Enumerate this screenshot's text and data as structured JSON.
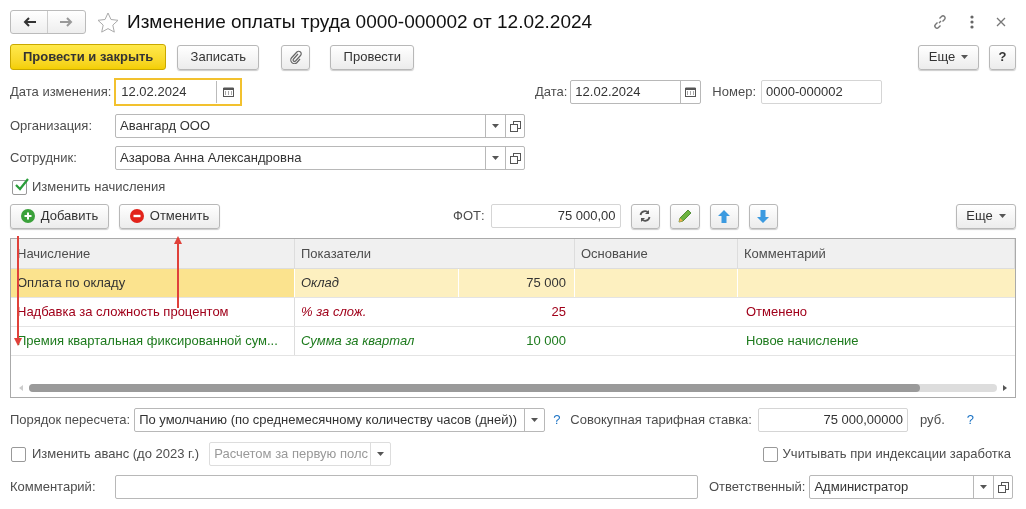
{
  "window": {
    "title": "Изменение оплаты труда 0000-000002 от 12.02.2024",
    "favorite": false
  },
  "toolbar": {
    "primary": "Провести и закрыть",
    "buttons": [
      "Записать",
      "Провести"
    ],
    "more": "Еще",
    "help": "?"
  },
  "header": {
    "change_date": {
      "label": "Дата изменения:",
      "value": "12.02.2024"
    },
    "date": {
      "label": "Дата:",
      "value": "12.02.2024"
    },
    "number": {
      "label": "Номер:",
      "value": "0000-000002"
    }
  },
  "organization": {
    "label": "Организация:",
    "value": "Авангард ООО"
  },
  "employee": {
    "label": "Сотрудник:",
    "value": "Азарова Анна Александровна"
  },
  "change_accruals": {
    "label": "Изменить начисления",
    "checked": true
  },
  "table_toolbar": {
    "add": "Добавить",
    "cancel": "Отменить",
    "fot_label": "ФОТ:",
    "fot_value": "75 000,00",
    "more": "Еще"
  },
  "table": {
    "columns": [
      "Начисление",
      "Показатели",
      "Основание",
      "Комментарий"
    ],
    "rows": [
      {
        "accrual": "Оплата по окладу",
        "indicator": "Оклад",
        "value": "75 000",
        "comment": "",
        "kind": "unchanged",
        "selected": true
      },
      {
        "accrual": "Надбавка за сложность процентом",
        "indicator": "% за слож.",
        "value": "25",
        "comment": "Отменено",
        "kind": "cancelled",
        "selected": false
      },
      {
        "accrual": "Премия квартальная фиксированной сум...",
        "indicator": "Сумма за квартал",
        "value": "10 000",
        "comment": "Новое начисление",
        "kind": "new",
        "selected": false
      }
    ]
  },
  "recalc": {
    "label": "Порядок пересчета:",
    "value": "По умолчанию (по среднемесячному количеству часов (дней))",
    "help": "?"
  },
  "rate": {
    "label": "Совокупная тарифная ставка:",
    "value": "75 000,00000",
    "unit": "руб.",
    "help": "?"
  },
  "advance": {
    "label": "Изменить аванс (до 2023 г.)",
    "checked": false,
    "method": "Расчетом за первую полс",
    "method_disabled": true
  },
  "indexation": {
    "label": "Учитывать при индексации заработка",
    "checked": false
  },
  "comment": {
    "label": "Комментарий:"
  },
  "responsible": {
    "label": "Ответственный:",
    "value": "Администратор"
  }
}
